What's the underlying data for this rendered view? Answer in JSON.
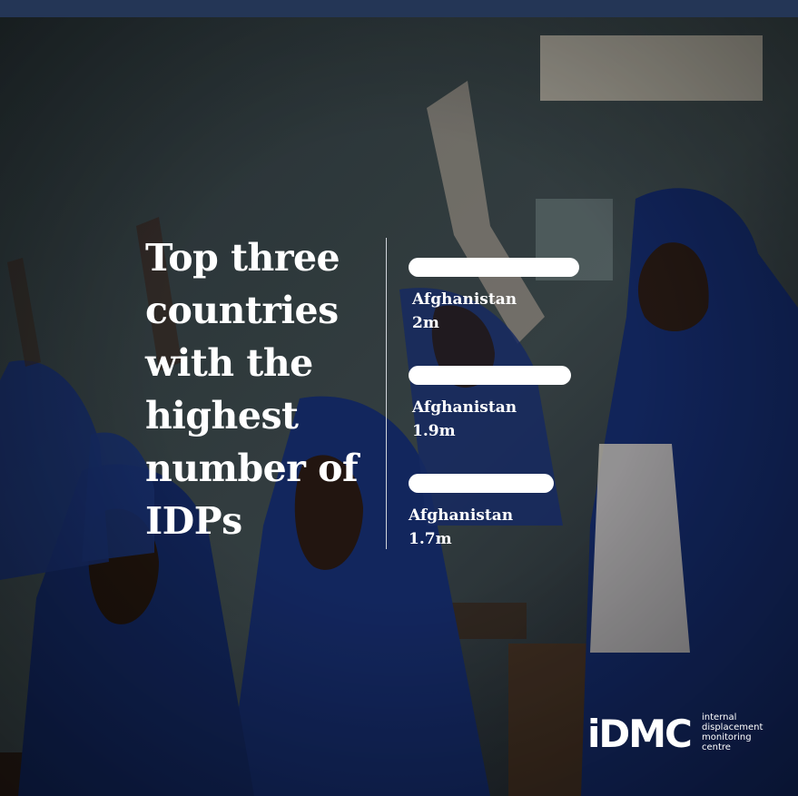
{
  "header": {
    "title_lines": [
      "Top three",
      "countries",
      "with the",
      "highest",
      "number of",
      "IDPs"
    ]
  },
  "chart_data": {
    "type": "bar",
    "categories": [
      "Afghanistan",
      "Afghanistan",
      "Afghanistan"
    ],
    "values": [
      2.0,
      1.9,
      1.7
    ],
    "value_labels": [
      "2m",
      "1.9m",
      "1.7m"
    ],
    "orientation": "horizontal",
    "bar_color": "#ffffff"
  },
  "logo": {
    "wordmark": "iDMC",
    "subtitle_lines": [
      "internal",
      "displacement",
      "monitoring",
      "centre"
    ]
  },
  "colors": {
    "top_bar": "#243656",
    "text": "#ffffff",
    "divider": "#d0d4da"
  }
}
